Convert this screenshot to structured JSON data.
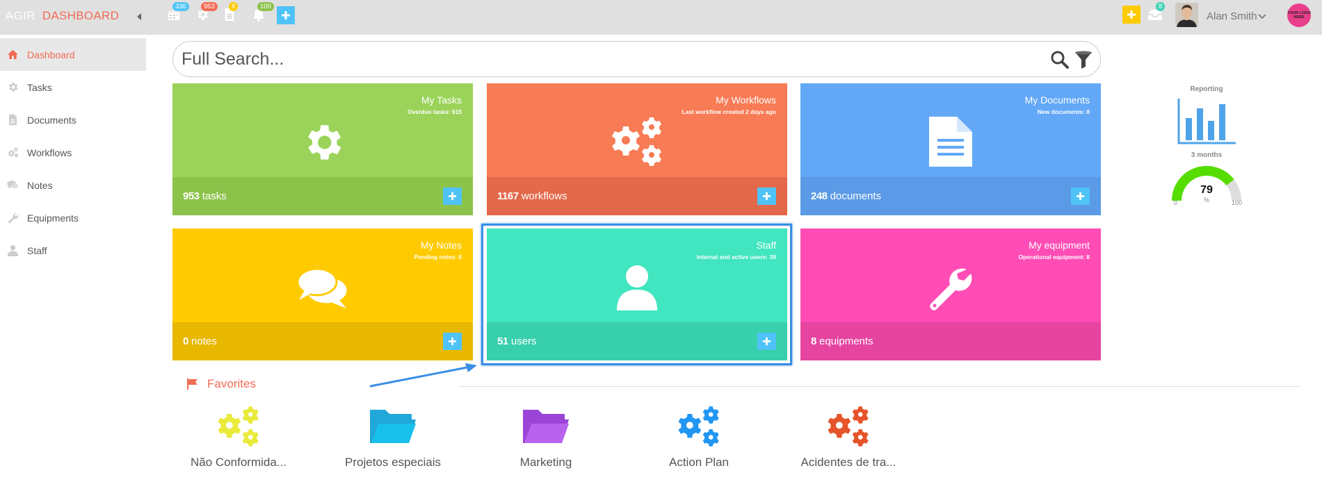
{
  "topbar": {
    "brand_prefix": "AGIR",
    "brand_title": "DASHBOARD",
    "badges": {
      "calendar": "336",
      "settings": "953",
      "documents": "8",
      "notifications": "100",
      "inbox": "8"
    },
    "user_name": "Alan Smith",
    "logo_text": "YOUR LOGO HERE"
  },
  "sidebar": {
    "items": [
      {
        "label": "Dashboard",
        "icon": "home-icon"
      },
      {
        "label": "Tasks",
        "icon": "gear-icon"
      },
      {
        "label": "Documents",
        "icon": "document-icon"
      },
      {
        "label": "Workflows",
        "icon": "gears-icon"
      },
      {
        "label": "Notes",
        "icon": "comments-icon"
      },
      {
        "label": "Equipments",
        "icon": "wrench-icon"
      },
      {
        "label": "Staff",
        "icon": "user-icon"
      }
    ]
  },
  "search": {
    "placeholder": "Full Search..."
  },
  "cards": [
    {
      "title": "My Tasks",
      "subtitle": "Overdue tasks: 915",
      "count": "953",
      "unit": "tasks",
      "color": "#9bd35a",
      "foot": "#8bc34a"
    },
    {
      "title": "My Workflows",
      "subtitle": "Last workflow created 2 days ago",
      "count": "1167",
      "unit": "workflows",
      "color": "#f77b55",
      "foot": "#e4684a"
    },
    {
      "title": "My Documents",
      "subtitle": "New documents: 8",
      "count": "248",
      "unit": "documents",
      "color": "#62a8f7",
      "foot": "#5a9ae6"
    },
    {
      "title": "My Notes",
      "subtitle": "Pending notes: 0",
      "count": "0",
      "unit": "notes",
      "color": "#ffcb00",
      "foot": "#e8b800"
    },
    {
      "title": "Staff",
      "subtitle": "Internal and active users: 39",
      "count": "51",
      "unit": "users",
      "color": "#41e5bf",
      "foot": "#38cfac"
    },
    {
      "title": "My equipment",
      "subtitle": "Operational equipment: 8",
      "count": "8",
      "unit": "equipments",
      "color": "#ff4db5",
      "foot": "#e5449f"
    }
  ],
  "reporting": {
    "title": "Reporting",
    "period": "3 months",
    "gauge_value": 79,
    "gauge_unit": "%",
    "gauge_min": "0",
    "gauge_max": "100"
  },
  "favorites": {
    "title": "Favorites",
    "items": [
      {
        "label": "Não Conformida...",
        "color": "#eaea3a"
      },
      {
        "label": "Projetos especiais",
        "color": "#1fa8d8"
      },
      {
        "label": "Marketing",
        "color": "#b05ae8"
      },
      {
        "label": "Action Plan",
        "color": "#2196f3"
      },
      {
        "label": "Acidentes de tra...",
        "color": "#e5542a"
      }
    ]
  },
  "colors": {
    "accent": "#f26b55",
    "add_button": "#4fc3f7",
    "highlight": "#3a8ee6"
  }
}
